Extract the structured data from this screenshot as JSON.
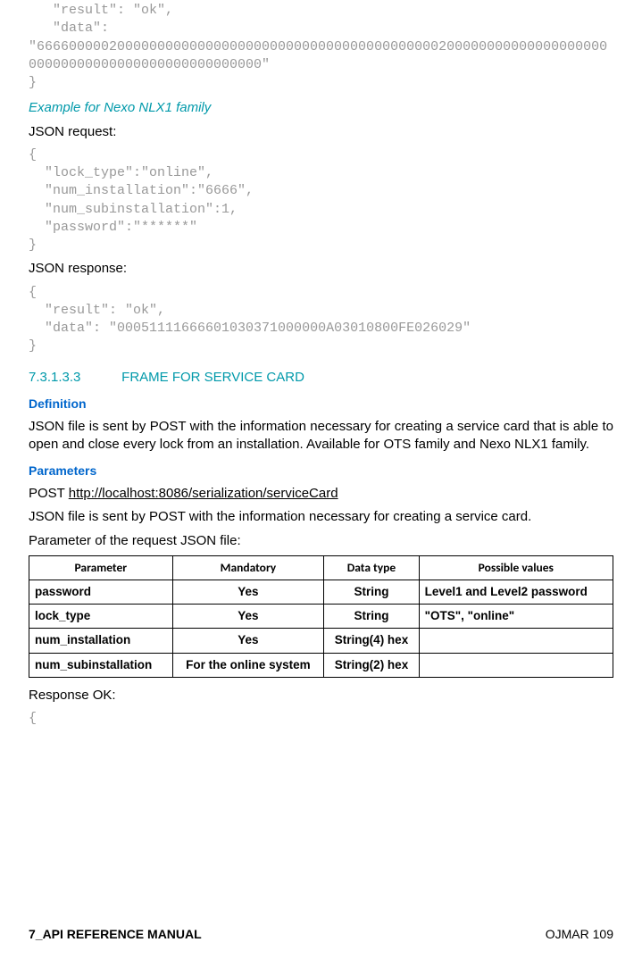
{
  "code_top": "   \"result\": \"ok\",\n   \"data\":\n\"6666000002000000000000000000000000000000000000000020000000000000000000000000000000000000000000000000\"\n}",
  "example_nexo_heading": "Example for Nexo NLX1 family",
  "json_request_label": "JSON request:",
  "code_request": "{\n  \"lock_type\":\"online\",\n  \"num_installation\":\"6666\",\n  \"num_subinstallation\":1,\n  \"password\":\"******\"\n}",
  "json_response_label": "JSON response:",
  "code_response": "{\n  \"result\": \"ok\",\n  \"data\": \"00051111666601030371000000A03010800FE026029\"\n}",
  "section": {
    "num": "7.3.1.3.3",
    "title": "FRAME FOR SERVICE CARD"
  },
  "definition_heading": "Definition",
  "definition_body": "JSON file is sent by POST with the information necessary for creating a service card that is able to open and close every lock from an installation. Available for OTS family and Nexo NLX1 family.",
  "parameters_heading": "Parameters",
  "post_prefix": "POST ",
  "post_url": "http://localhost:8086/serialization/serviceCard",
  "post_body": "JSON file is sent by POST with the information necessary for creating a service card.",
  "param_intro": "Parameter of the request JSON file:",
  "table": {
    "headers": [
      "Parameter",
      "Mandatory",
      "Data type",
      "Possible values"
    ],
    "rows": [
      {
        "param": "password",
        "mandatory": "Yes",
        "type": "String",
        "possible": "Level1 and Level2 password"
      },
      {
        "param": "lock_type",
        "mandatory": "Yes",
        "type": "String",
        "possible": "\"OTS\", \"online\""
      },
      {
        "param": "num_installation",
        "mandatory": "Yes",
        "type": "String(4) hex",
        "possible": ""
      },
      {
        "param": "num_subinstallation",
        "mandatory": "For the online system",
        "type": "String(2) hex",
        "possible": ""
      }
    ]
  },
  "response_ok_label": "Response OK:",
  "code_brace": "{",
  "footer": {
    "left": "7_API REFERENCE MANUAL",
    "right": "OJMAR 109"
  }
}
